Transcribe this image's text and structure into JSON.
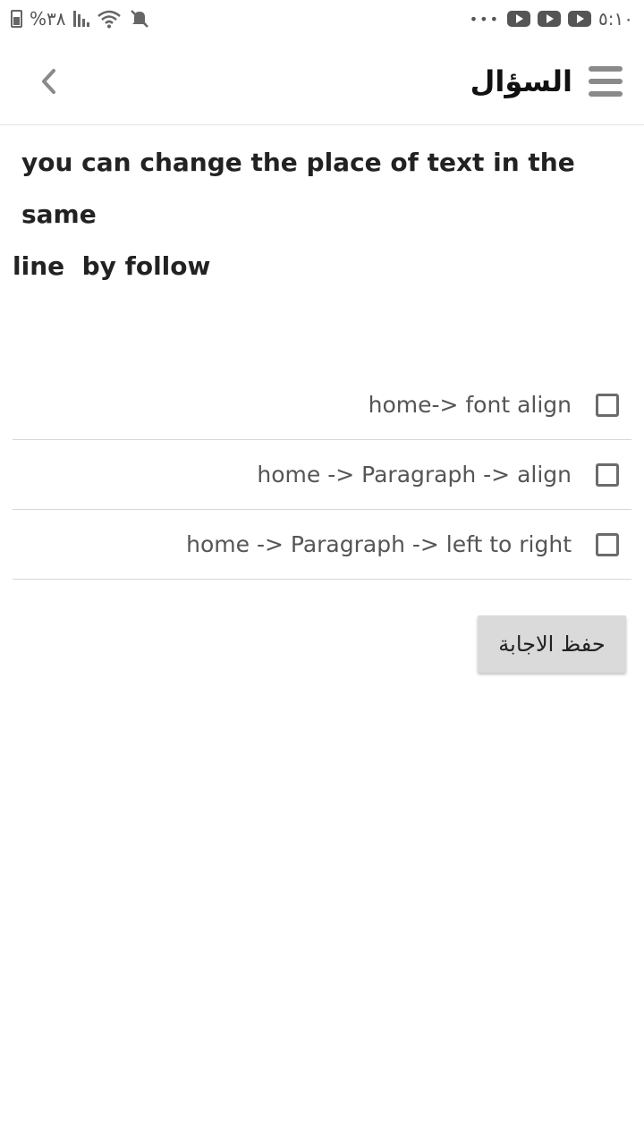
{
  "status_bar": {
    "battery_text": "%٣٨",
    "time": "٥:١٠",
    "icons": [
      "battery-icon",
      "signal-icon",
      "wifi-icon",
      "mute-icon",
      "more-dots-icon",
      "youtube-icon",
      "youtube-icon",
      "youtube-icon"
    ]
  },
  "header": {
    "title": "السؤال",
    "menu_icon": "hamburger-menu-icon",
    "back_icon": "chevron-left-icon"
  },
  "question": {
    "line1": "you can change the place of text in the same",
    "line2": "line  by follow"
  },
  "options": [
    {
      "label": "home-> font align",
      "checked": false
    },
    {
      "label": "home -> Paragraph -> align",
      "checked": false
    },
    {
      "label": "home -> Paragraph -> left to right",
      "checked": false
    }
  ],
  "save_button": {
    "label": "حفظ الاجابة"
  }
}
